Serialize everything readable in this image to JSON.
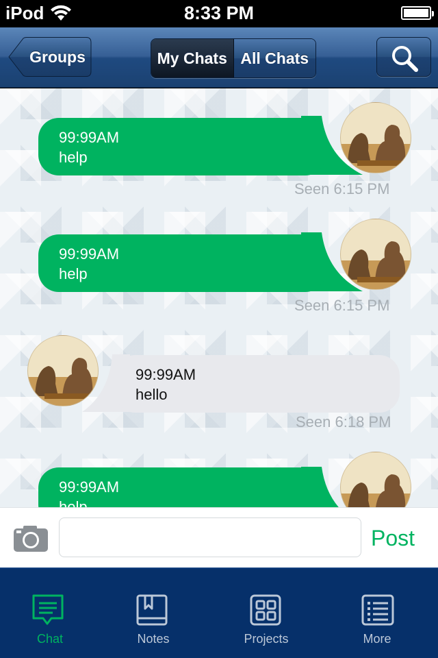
{
  "status_bar": {
    "carrier": "iPod",
    "time": "8:33 PM",
    "battery_icon": "battery-full-icon",
    "wifi_icon": "wifi-icon"
  },
  "nav": {
    "back_label": "Groups",
    "tabs": [
      {
        "label": "My Chats",
        "active": true
      },
      {
        "label": "All Chats",
        "active": false
      }
    ],
    "search_icon": "magnifier-icon"
  },
  "messages": [
    {
      "direction": "outgoing",
      "timestamp": "99:99AM",
      "text": "help",
      "seen": "Seen 6:15 PM"
    },
    {
      "direction": "outgoing",
      "timestamp": "99:99AM",
      "text": "help",
      "seen": "Seen 6:15 PM"
    },
    {
      "direction": "incoming",
      "timestamp": "99:99AM",
      "text": "hello",
      "seen": "Seen 6:18 PM"
    },
    {
      "direction": "outgoing",
      "timestamp": "99:99AM",
      "text": "help",
      "seen": ""
    }
  ],
  "composer": {
    "camera_icon": "camera-icon",
    "input_value": "",
    "input_placeholder": "",
    "post_label": "Post"
  },
  "tab_bar": {
    "tabs": [
      {
        "label": "Chat",
        "icon": "chat-bubble-icon",
        "active": true
      },
      {
        "label": "Notes",
        "icon": "book-icon",
        "active": false
      },
      {
        "label": "Projects",
        "icon": "grid-icon",
        "active": false
      },
      {
        "label": "More",
        "icon": "list-icon",
        "active": false
      }
    ]
  },
  "colors": {
    "accent_green": "#00b360",
    "nav_blue": "#1f4a80",
    "tab_bar_blue": "#06306a",
    "incoming_bubble": "#e8e9ed"
  }
}
